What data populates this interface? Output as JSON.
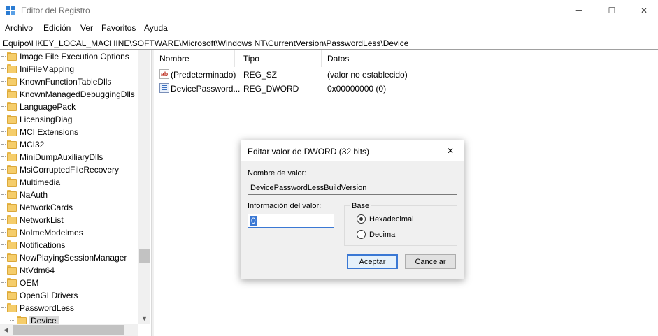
{
  "window": {
    "title": "Editor del Registro",
    "minimize_glyph": "─",
    "maximize_glyph": "☐",
    "close_glyph": "✕",
    "app_icon": "registry-editor-icon"
  },
  "menu": [
    "Archivo",
    "Edición",
    "Ver",
    "Favoritos",
    "Ayuda"
  ],
  "address": "Equipo\\HKEY_LOCAL_MACHINE\\SOFTWARE\\Microsoft\\Windows NT\\CurrentVersion\\PasswordLess\\Device",
  "tree": {
    "items": [
      "Image File Execution Options",
      "IniFileMapping",
      "KnownFunctionTableDlls",
      "KnownManagedDebuggingDlls",
      "LanguagePack",
      "LicensingDiag",
      "MCI Extensions",
      "MCI32",
      "MiniDumpAuxiliaryDlls",
      "MsiCorruptedFileRecovery",
      "Multimedia",
      "NaAuth",
      "NetworkCards",
      "NetworkList",
      "NoImeModelmes",
      "Notifications",
      "NowPlayingSessionManager",
      "NtVdm64",
      "OEM",
      "OpenGLDrivers",
      "PasswordLess"
    ],
    "selected": "Device",
    "scroll_down_glyph": "▼",
    "scroll_left_glyph": "◀"
  },
  "list": {
    "columns": [
      "Nombre",
      "Tipo",
      "Datos"
    ],
    "rows": [
      {
        "name": "(Predeterminado)",
        "type": "REG_SZ",
        "data": "(valor no establecido)",
        "icon": "string-value-icon",
        "icon_text": "ab"
      },
      {
        "name": "DevicePassword...",
        "type": "REG_DWORD",
        "data": "0x00000000 (0)",
        "icon": "dword-value-icon"
      }
    ]
  },
  "dialog": {
    "title": "Editar valor de DWORD (32 bits)",
    "close_glyph": "✕",
    "name_label": "Nombre de valor:",
    "name_value": "DevicePasswordLessBuildVersion",
    "data_label": "Información del valor:",
    "data_value": "0",
    "base_label": "Base",
    "radio_hex": "Hexadecimal",
    "radio_dec": "Decimal",
    "selected_base": "Hexadecimal",
    "ok": "Aceptar",
    "cancel": "Cancelar"
  }
}
